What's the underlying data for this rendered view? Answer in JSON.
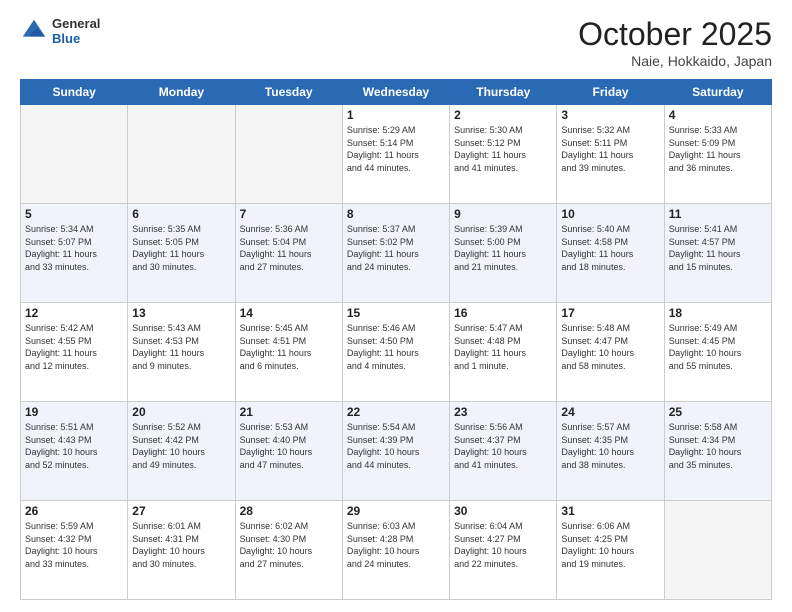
{
  "header": {
    "logo_general": "General",
    "logo_blue": "Blue",
    "month": "October 2025",
    "location": "Naie, Hokkaido, Japan"
  },
  "weekdays": [
    "Sunday",
    "Monday",
    "Tuesday",
    "Wednesday",
    "Thursday",
    "Friday",
    "Saturday"
  ],
  "weeks": [
    [
      {
        "day": "",
        "info": ""
      },
      {
        "day": "",
        "info": ""
      },
      {
        "day": "",
        "info": ""
      },
      {
        "day": "1",
        "info": "Sunrise: 5:29 AM\nSunset: 5:14 PM\nDaylight: 11 hours\nand 44 minutes."
      },
      {
        "day": "2",
        "info": "Sunrise: 5:30 AM\nSunset: 5:12 PM\nDaylight: 11 hours\nand 41 minutes."
      },
      {
        "day": "3",
        "info": "Sunrise: 5:32 AM\nSunset: 5:11 PM\nDaylight: 11 hours\nand 39 minutes."
      },
      {
        "day": "4",
        "info": "Sunrise: 5:33 AM\nSunset: 5:09 PM\nDaylight: 11 hours\nand 36 minutes."
      }
    ],
    [
      {
        "day": "5",
        "info": "Sunrise: 5:34 AM\nSunset: 5:07 PM\nDaylight: 11 hours\nand 33 minutes."
      },
      {
        "day": "6",
        "info": "Sunrise: 5:35 AM\nSunset: 5:05 PM\nDaylight: 11 hours\nand 30 minutes."
      },
      {
        "day": "7",
        "info": "Sunrise: 5:36 AM\nSunset: 5:04 PM\nDaylight: 11 hours\nand 27 minutes."
      },
      {
        "day": "8",
        "info": "Sunrise: 5:37 AM\nSunset: 5:02 PM\nDaylight: 11 hours\nand 24 minutes."
      },
      {
        "day": "9",
        "info": "Sunrise: 5:39 AM\nSunset: 5:00 PM\nDaylight: 11 hours\nand 21 minutes."
      },
      {
        "day": "10",
        "info": "Sunrise: 5:40 AM\nSunset: 4:58 PM\nDaylight: 11 hours\nand 18 minutes."
      },
      {
        "day": "11",
        "info": "Sunrise: 5:41 AM\nSunset: 4:57 PM\nDaylight: 11 hours\nand 15 minutes."
      }
    ],
    [
      {
        "day": "12",
        "info": "Sunrise: 5:42 AM\nSunset: 4:55 PM\nDaylight: 11 hours\nand 12 minutes."
      },
      {
        "day": "13",
        "info": "Sunrise: 5:43 AM\nSunset: 4:53 PM\nDaylight: 11 hours\nand 9 minutes."
      },
      {
        "day": "14",
        "info": "Sunrise: 5:45 AM\nSunset: 4:51 PM\nDaylight: 11 hours\nand 6 minutes."
      },
      {
        "day": "15",
        "info": "Sunrise: 5:46 AM\nSunset: 4:50 PM\nDaylight: 11 hours\nand 4 minutes."
      },
      {
        "day": "16",
        "info": "Sunrise: 5:47 AM\nSunset: 4:48 PM\nDaylight: 11 hours\nand 1 minute."
      },
      {
        "day": "17",
        "info": "Sunrise: 5:48 AM\nSunset: 4:47 PM\nDaylight: 10 hours\nand 58 minutes."
      },
      {
        "day": "18",
        "info": "Sunrise: 5:49 AM\nSunset: 4:45 PM\nDaylight: 10 hours\nand 55 minutes."
      }
    ],
    [
      {
        "day": "19",
        "info": "Sunrise: 5:51 AM\nSunset: 4:43 PM\nDaylight: 10 hours\nand 52 minutes."
      },
      {
        "day": "20",
        "info": "Sunrise: 5:52 AM\nSunset: 4:42 PM\nDaylight: 10 hours\nand 49 minutes."
      },
      {
        "day": "21",
        "info": "Sunrise: 5:53 AM\nSunset: 4:40 PM\nDaylight: 10 hours\nand 47 minutes."
      },
      {
        "day": "22",
        "info": "Sunrise: 5:54 AM\nSunset: 4:39 PM\nDaylight: 10 hours\nand 44 minutes."
      },
      {
        "day": "23",
        "info": "Sunrise: 5:56 AM\nSunset: 4:37 PM\nDaylight: 10 hours\nand 41 minutes."
      },
      {
        "day": "24",
        "info": "Sunrise: 5:57 AM\nSunset: 4:35 PM\nDaylight: 10 hours\nand 38 minutes."
      },
      {
        "day": "25",
        "info": "Sunrise: 5:58 AM\nSunset: 4:34 PM\nDaylight: 10 hours\nand 35 minutes."
      }
    ],
    [
      {
        "day": "26",
        "info": "Sunrise: 5:59 AM\nSunset: 4:32 PM\nDaylight: 10 hours\nand 33 minutes."
      },
      {
        "day": "27",
        "info": "Sunrise: 6:01 AM\nSunset: 4:31 PM\nDaylight: 10 hours\nand 30 minutes."
      },
      {
        "day": "28",
        "info": "Sunrise: 6:02 AM\nSunset: 4:30 PM\nDaylight: 10 hours\nand 27 minutes."
      },
      {
        "day": "29",
        "info": "Sunrise: 6:03 AM\nSunset: 4:28 PM\nDaylight: 10 hours\nand 24 minutes."
      },
      {
        "day": "30",
        "info": "Sunrise: 6:04 AM\nSunset: 4:27 PM\nDaylight: 10 hours\nand 22 minutes."
      },
      {
        "day": "31",
        "info": "Sunrise: 6:06 AM\nSunset: 4:25 PM\nDaylight: 10 hours\nand 19 minutes."
      },
      {
        "day": "",
        "info": ""
      }
    ]
  ]
}
